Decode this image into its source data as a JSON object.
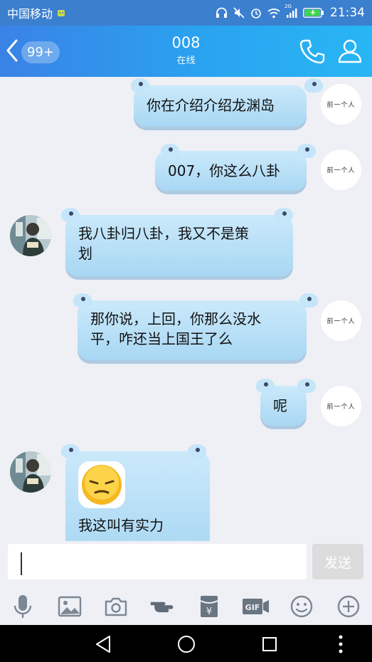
{
  "status_bar": {
    "carrier": "中国移动",
    "network": "2G",
    "time": "21:34",
    "icons": [
      "bot-icon",
      "headset-icon",
      "mute-icon",
      "alarm-icon",
      "wifi-icon",
      "signal-icon",
      "battery-icon"
    ]
  },
  "header": {
    "unread_count": "99+",
    "title": "008",
    "status": "在线",
    "accent_colors": [
      "#3a82e6",
      "#28b6f4"
    ]
  },
  "messages": [
    {
      "side": "right",
      "text": "你在介绍介绍龙渊岛"
    },
    {
      "side": "right",
      "text": "007，你这么八卦"
    },
    {
      "side": "left",
      "lines": [
        "我八卦归八卦，我又不是策",
        "划"
      ]
    },
    {
      "side": "right",
      "lines": [
        "那你说，上回，你那么没水",
        "平，咋还当上国王了么"
      ]
    },
    {
      "side": "right",
      "text": "呢"
    },
    {
      "side": "left",
      "emoji": "awkward-face-emoji",
      "text": "我这叫有实力"
    }
  ],
  "self_avatar_text": "前一个人",
  "input": {
    "value": "",
    "send_label": "发送"
  },
  "toolbar": {
    "items": [
      "microphone-icon",
      "image-icon",
      "camera-icon",
      "poke-icon",
      "red-packet-icon",
      "gif-icon",
      "emoji-icon",
      "plus-icon"
    ],
    "gif_label": "GIF",
    "yen_label": "¥"
  },
  "nav": [
    "back-triangle-icon",
    "home-circle-icon",
    "recents-square-icon",
    "more-dots-icon"
  ]
}
